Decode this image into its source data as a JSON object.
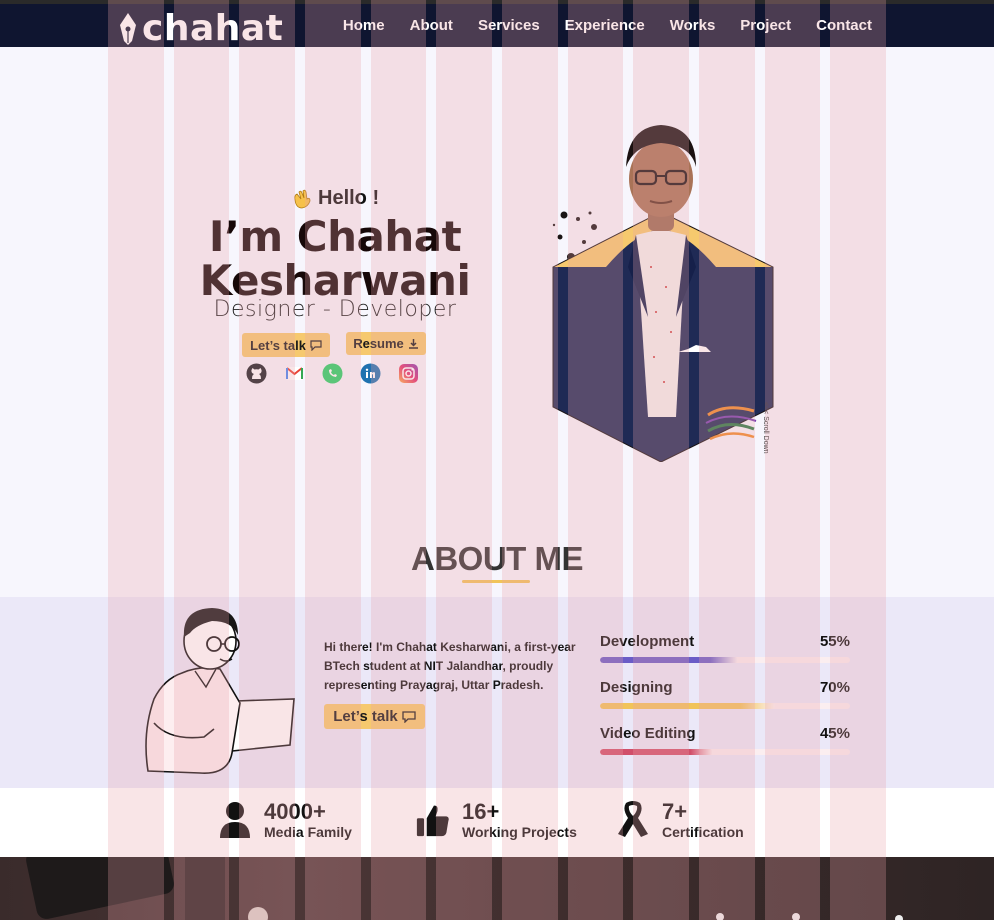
{
  "nav": {
    "logo_text": "chahat",
    "links": [
      "Home",
      "About",
      "Services",
      "Experience",
      "Works",
      "Project",
      "Contact"
    ]
  },
  "hero": {
    "greeting": "Hello !",
    "name_line1": "I’m Chahat",
    "name_line2": "Kesharwani",
    "role": "Designer - Developer",
    "talk_button": "Let’s talk",
    "resume_button": "Resume",
    "socials": [
      "github-icon",
      "gmail-icon",
      "whatsapp-icon",
      "linkedin-icon",
      "instagram-icon"
    ],
    "scroll_down": "<<< Scroll Down"
  },
  "about": {
    "title": "ABOUT ME",
    "bio": "Hi there! I'm Chahat Kesharwani, a first-year BTech student at NIT Jalandhar, proudly representing Prayagraj, Uttar Pradesh.",
    "talk_button": "Let’s talk",
    "skills": [
      {
        "label": "Development",
        "value": "55%",
        "level": 0.55,
        "color": "#6a5cc7"
      },
      {
        "label": "Designing",
        "value": "70%",
        "level": 0.7,
        "color": "#f1c45a"
      },
      {
        "label": "Video Editing",
        "value": "45%",
        "level": 0.45,
        "color": "#d14f6a"
      }
    ]
  },
  "stats": [
    {
      "number": "4000+",
      "label": "Media Family",
      "icon": "person-icon"
    },
    {
      "number": "16+",
      "label": "Working Projects",
      "icon": "thumbs-up-icon"
    },
    {
      "number": "7+",
      "label": "Certification",
      "icon": "ribbon-icon"
    }
  ],
  "colors": {
    "nav_bg": "#0f1530",
    "accent_yellow": "#f6c96e",
    "hero_bg": "#f7f6fd",
    "about_band": "#ebe8f8"
  }
}
